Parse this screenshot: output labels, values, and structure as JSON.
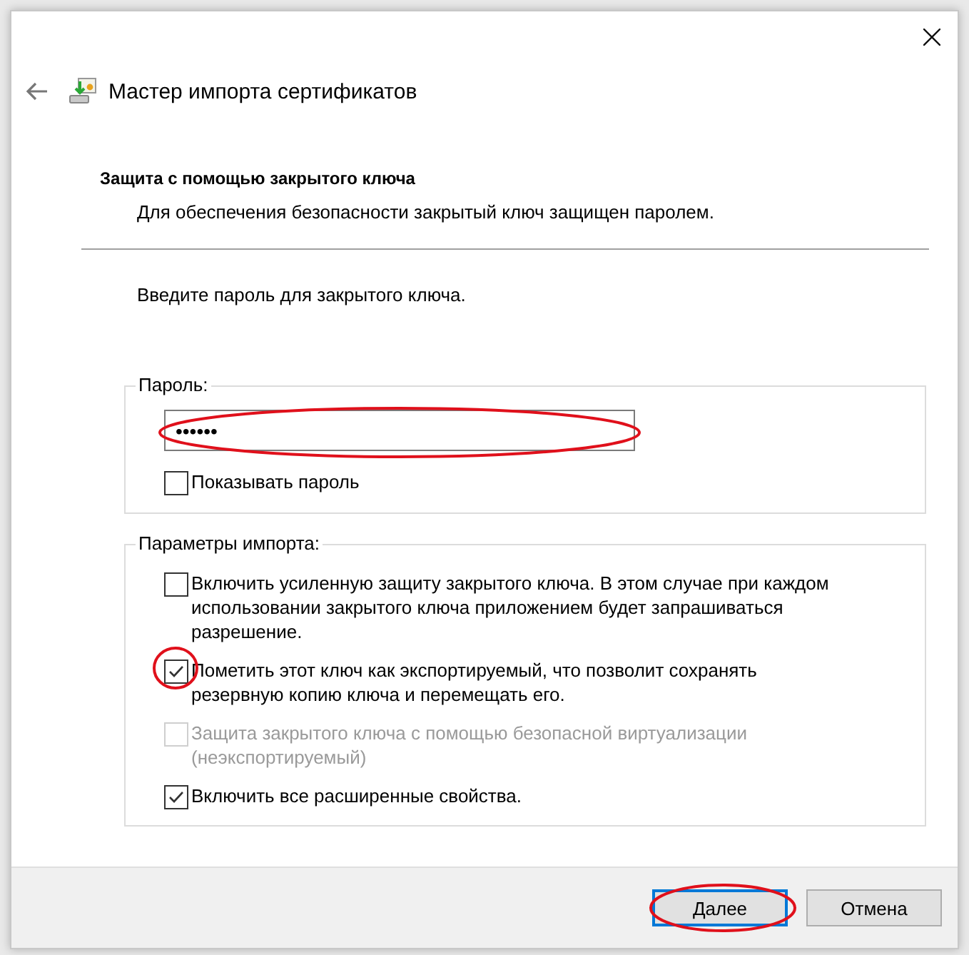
{
  "window": {
    "title": "Мастер импорта сертификатов"
  },
  "heading": "Защита с помощью закрытого ключа",
  "subheading": "Для обеспечения безопасности закрытый ключ защищен паролем.",
  "prompt": "Введите пароль для закрытого ключа.",
  "password_group": {
    "legend": "Пароль:",
    "value": "••••••",
    "show_password": {
      "label": "Показывать пароль",
      "checked": false
    }
  },
  "import_options": {
    "legend": "Параметры импорта:",
    "options": [
      {
        "label": "Включить усиленную защиту закрытого ключа. В этом случае при каждом использовании закрытого ключа приложением будет запрашиваться разрешение.",
        "checked": false,
        "disabled": false
      },
      {
        "label": "Пометить этот ключ как экспортируемый, что позволит сохранять резервную копию ключа и перемещать его.",
        "checked": true,
        "disabled": false
      },
      {
        "label": "Защита закрытого ключа с помощью безопасной виртуализации (неэкспортируемый)",
        "checked": false,
        "disabled": true
      },
      {
        "label": "Включить все расширенные свойства.",
        "checked": true,
        "disabled": false
      }
    ]
  },
  "buttons": [
    {
      "label": "Далее",
      "default": true
    },
    {
      "label": "Отмена",
      "default": false
    }
  ]
}
